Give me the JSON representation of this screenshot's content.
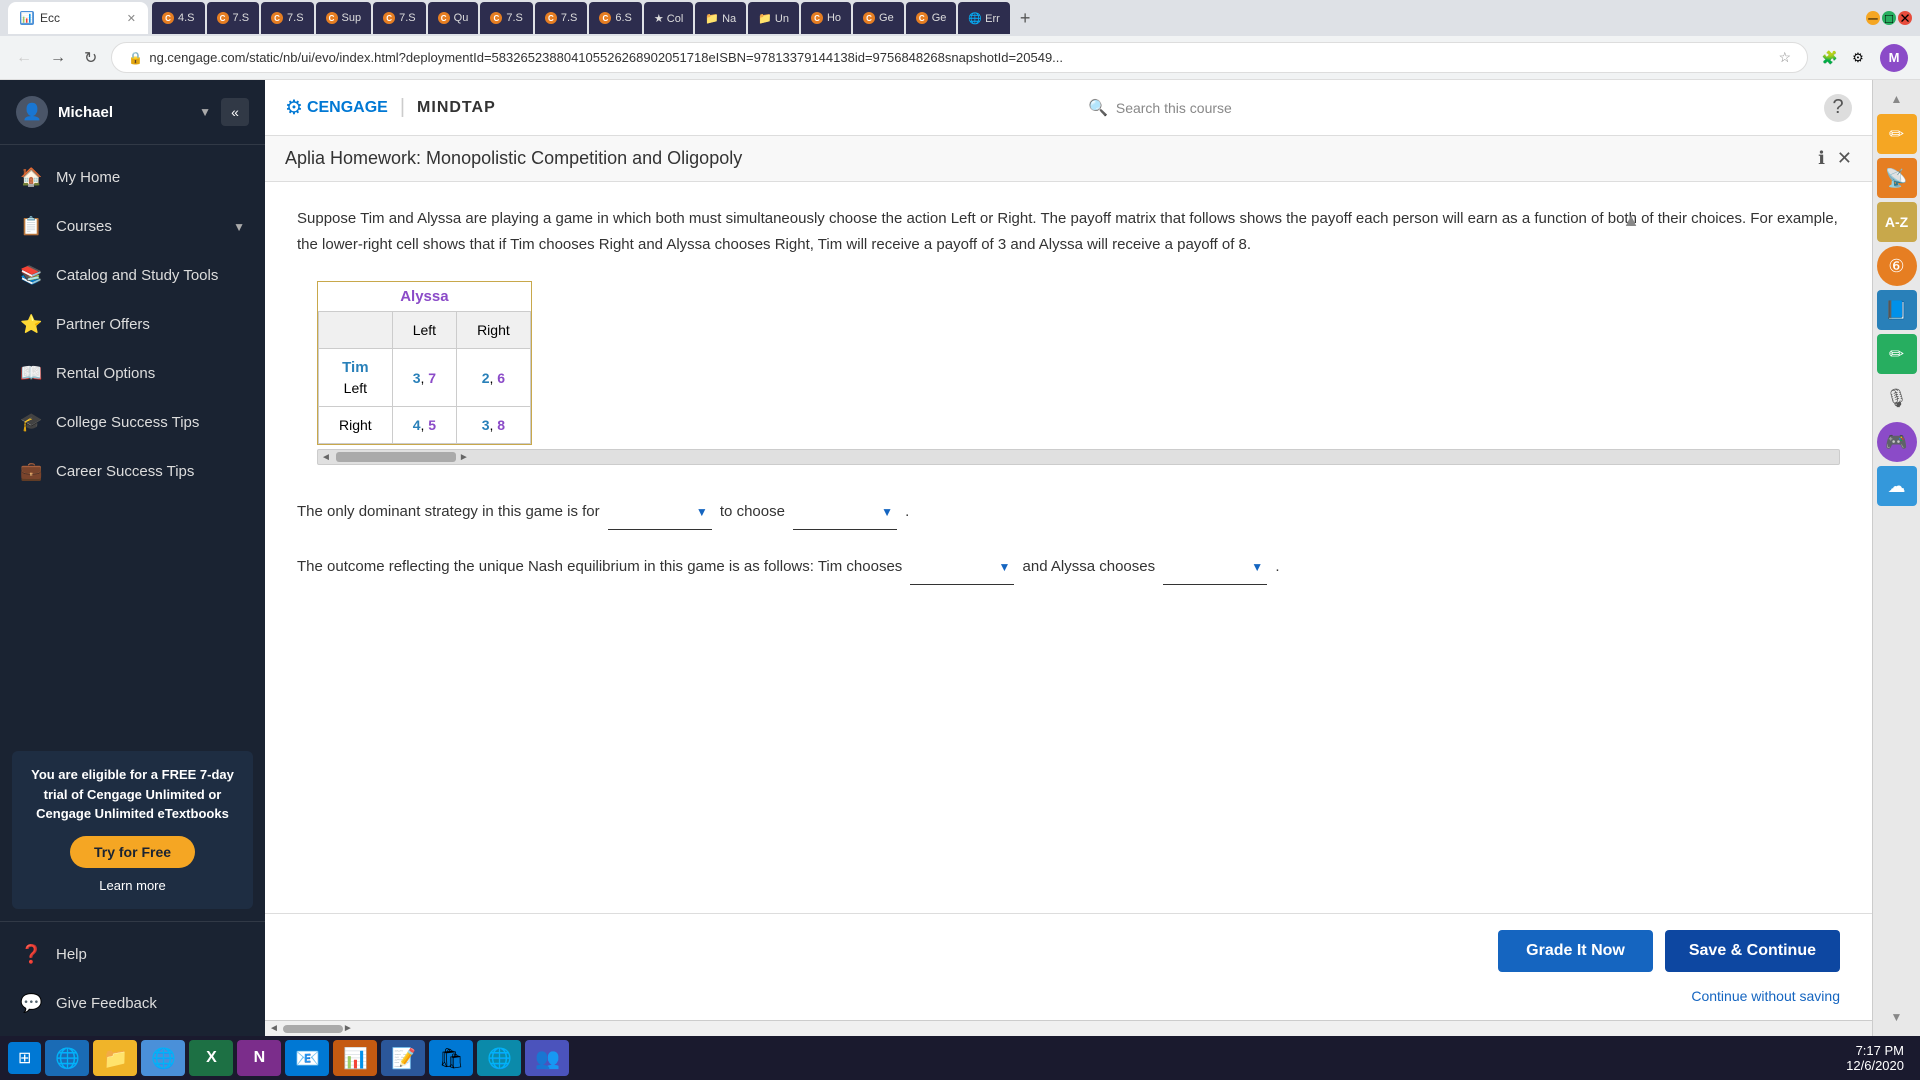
{
  "browser": {
    "tabs": [
      {
        "label": "Ecc",
        "icon": "📊",
        "active": true
      },
      {
        "label": "4.S",
        "icon": "C",
        "active": false
      },
      {
        "label": "7.S",
        "icon": "C",
        "active": false
      },
      {
        "label": "7.S",
        "icon": "C",
        "active": false
      },
      {
        "label": "Sup",
        "icon": "C",
        "active": false
      },
      {
        "label": "7.S",
        "icon": "C",
        "active": false
      },
      {
        "label": "Qu",
        "icon": "C",
        "active": false
      },
      {
        "label": "7.S",
        "icon": "C",
        "active": false
      },
      {
        "label": "7.S",
        "icon": "C",
        "active": false
      },
      {
        "label": "6.S",
        "icon": "C",
        "active": false
      },
      {
        "label": "Col",
        "icon": "★",
        "active": false
      },
      {
        "label": "Na",
        "icon": "📁",
        "active": false
      },
      {
        "label": "Un",
        "icon": "📁",
        "active": false
      },
      {
        "label": "Ho",
        "icon": "C",
        "active": false
      },
      {
        "label": "Ge",
        "icon": "C",
        "active": false
      },
      {
        "label": "Ge",
        "icon": "C",
        "active": false
      },
      {
        "label": "Err",
        "icon": "🌐",
        "active": false
      }
    ],
    "url": "ng.cengage.com/static/nb/ui/evo/index.html?deploymentId=583265238804105526268902051718eISBN=97813379144138id=9756848268snapshotId=20549...",
    "user_initial": "M"
  },
  "sidebar": {
    "user_name": "Michael",
    "items": [
      {
        "label": "My Home",
        "icon": "🏠"
      },
      {
        "label": "Courses",
        "icon": "📋",
        "has_chevron": true
      },
      {
        "label": "Catalog and Study Tools",
        "icon": "📚"
      },
      {
        "label": "Partner Offers",
        "icon": "⭐"
      },
      {
        "label": "Rental Options",
        "icon": "📖"
      },
      {
        "label": "College Success Tips",
        "icon": "🎓"
      },
      {
        "label": "Career Success Tips",
        "icon": "💼"
      }
    ],
    "promo": {
      "text": "You are eligible for a FREE 7-day trial of Cengage Unlimited or Cengage Unlimited eTextbooks",
      "try_free_label": "Try for Free",
      "learn_more_label": "Learn more"
    },
    "bottom_items": [
      {
        "label": "Help",
        "icon": "❓"
      },
      {
        "label": "Give Feedback",
        "icon": "💬"
      }
    ]
  },
  "mindtap": {
    "cengage_label": "CENGAGE",
    "mindtap_label": "MINDTAP",
    "search_placeholder": "Search this course",
    "help_icon": "?"
  },
  "homework": {
    "title": "Aplia Homework: Monopolistic Competition and Oligopoly",
    "question_text": "Suppose Tim and Alyssa are playing a game in which both must simultaneously choose the action Left or Right. The payoff matrix that follows shows the payoff each person will earn as a function of both of their choices. For example, the lower-right cell shows that if Tim chooses Right and Alyssa chooses Right, Tim will receive a payoff of 3 and Alyssa will receive a payoff of 8.",
    "matrix": {
      "col_label": "Alyssa",
      "row_label": "Tim",
      "col_headers": [
        "Left",
        "Right"
      ],
      "rows": [
        {
          "label": "Left",
          "cells": [
            "3, 7",
            "2, 6"
          ]
        },
        {
          "label": "Right",
          "cells": [
            "4, 5",
            "3, 8"
          ]
        }
      ]
    },
    "q1_text_before": "The only dominant strategy in this game is for",
    "q1_text_middle": "to choose",
    "q1_text_after": ".",
    "q1_dropdown1_placeholder": "",
    "q1_dropdown2_placeholder": "",
    "q2_text_before": "The outcome reflecting the unique Nash equilibrium in this game is as follows: Tim chooses",
    "q2_text_middle": "and Alyssa chooses",
    "q2_text_after": ".",
    "q2_dropdown1_placeholder": "",
    "q2_dropdown2_placeholder": "",
    "grade_btn_label": "Grade It Now",
    "save_btn_label": "Save & Continue",
    "continue_link_label": "Continue without saving"
  },
  "right_sidebar": {
    "icons": [
      {
        "symbol": "✏️",
        "color": "yellow",
        "name": "edit-icon"
      },
      {
        "symbol": "📡",
        "color": "orange",
        "name": "rss-icon"
      },
      {
        "symbol": "A-Z",
        "color": "gray",
        "name": "az-icon"
      },
      {
        "symbol": "⊕",
        "color": "orange",
        "name": "passoport-icon"
      },
      {
        "symbol": "📘",
        "color": "blue",
        "name": "book-icon"
      },
      {
        "symbol": "✏",
        "color": "green",
        "name": "write-icon"
      },
      {
        "symbol": "((",
        "color": "gray",
        "name": "audio-icon"
      },
      {
        "symbol": "🎮",
        "color": "purple",
        "name": "game-icon"
      },
      {
        "symbol": "☁",
        "color": "blue-light",
        "name": "cloud-icon"
      }
    ]
  },
  "taskbar": {
    "time": "7:17 PM",
    "date": "12/6/2020",
    "apps": [
      "🪟",
      "🌐",
      "📁",
      "🌐",
      "X",
      "N",
      "📧",
      "📊",
      "📝",
      "🛍",
      "🌐",
      "👥"
    ]
  }
}
